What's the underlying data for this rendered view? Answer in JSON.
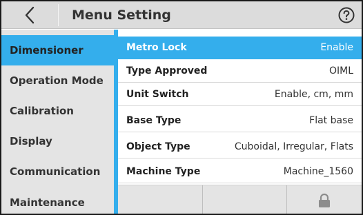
{
  "header": {
    "title": "Menu Setting",
    "back_icon": "chevron-left-icon",
    "help_icon": "question-circle-icon"
  },
  "sidebar": {
    "items": [
      {
        "label": "Dimensioner",
        "active": true
      },
      {
        "label": "Operation Mode",
        "active": false
      },
      {
        "label": "Calibration",
        "active": false
      },
      {
        "label": "Display",
        "active": false
      },
      {
        "label": "Communication",
        "active": false
      },
      {
        "label": "Maintenance",
        "active": false
      }
    ]
  },
  "main": {
    "rows": [
      {
        "label": "Metro Lock",
        "value": "Enable",
        "active": true
      },
      {
        "label": "Type Approved",
        "value": "OIML",
        "active": false
      },
      {
        "label": "Unit Switch",
        "value": "Enable, cm, mm",
        "active": false
      },
      {
        "label": "Base Type",
        "value": "Flat base",
        "active": false
      },
      {
        "label": "Object Type",
        "value": "Cuboidal, Irregular, Flats",
        "active": false
      },
      {
        "label": "Machine Type",
        "value": "Machine_1560",
        "active": false
      }
    ]
  },
  "buttonbar": {
    "lock_icon": "lock-icon"
  },
  "colors": {
    "accent": "#34aeec",
    "header_bg": "#dcdcdc",
    "sidebar_bg": "#e4e4e4"
  }
}
